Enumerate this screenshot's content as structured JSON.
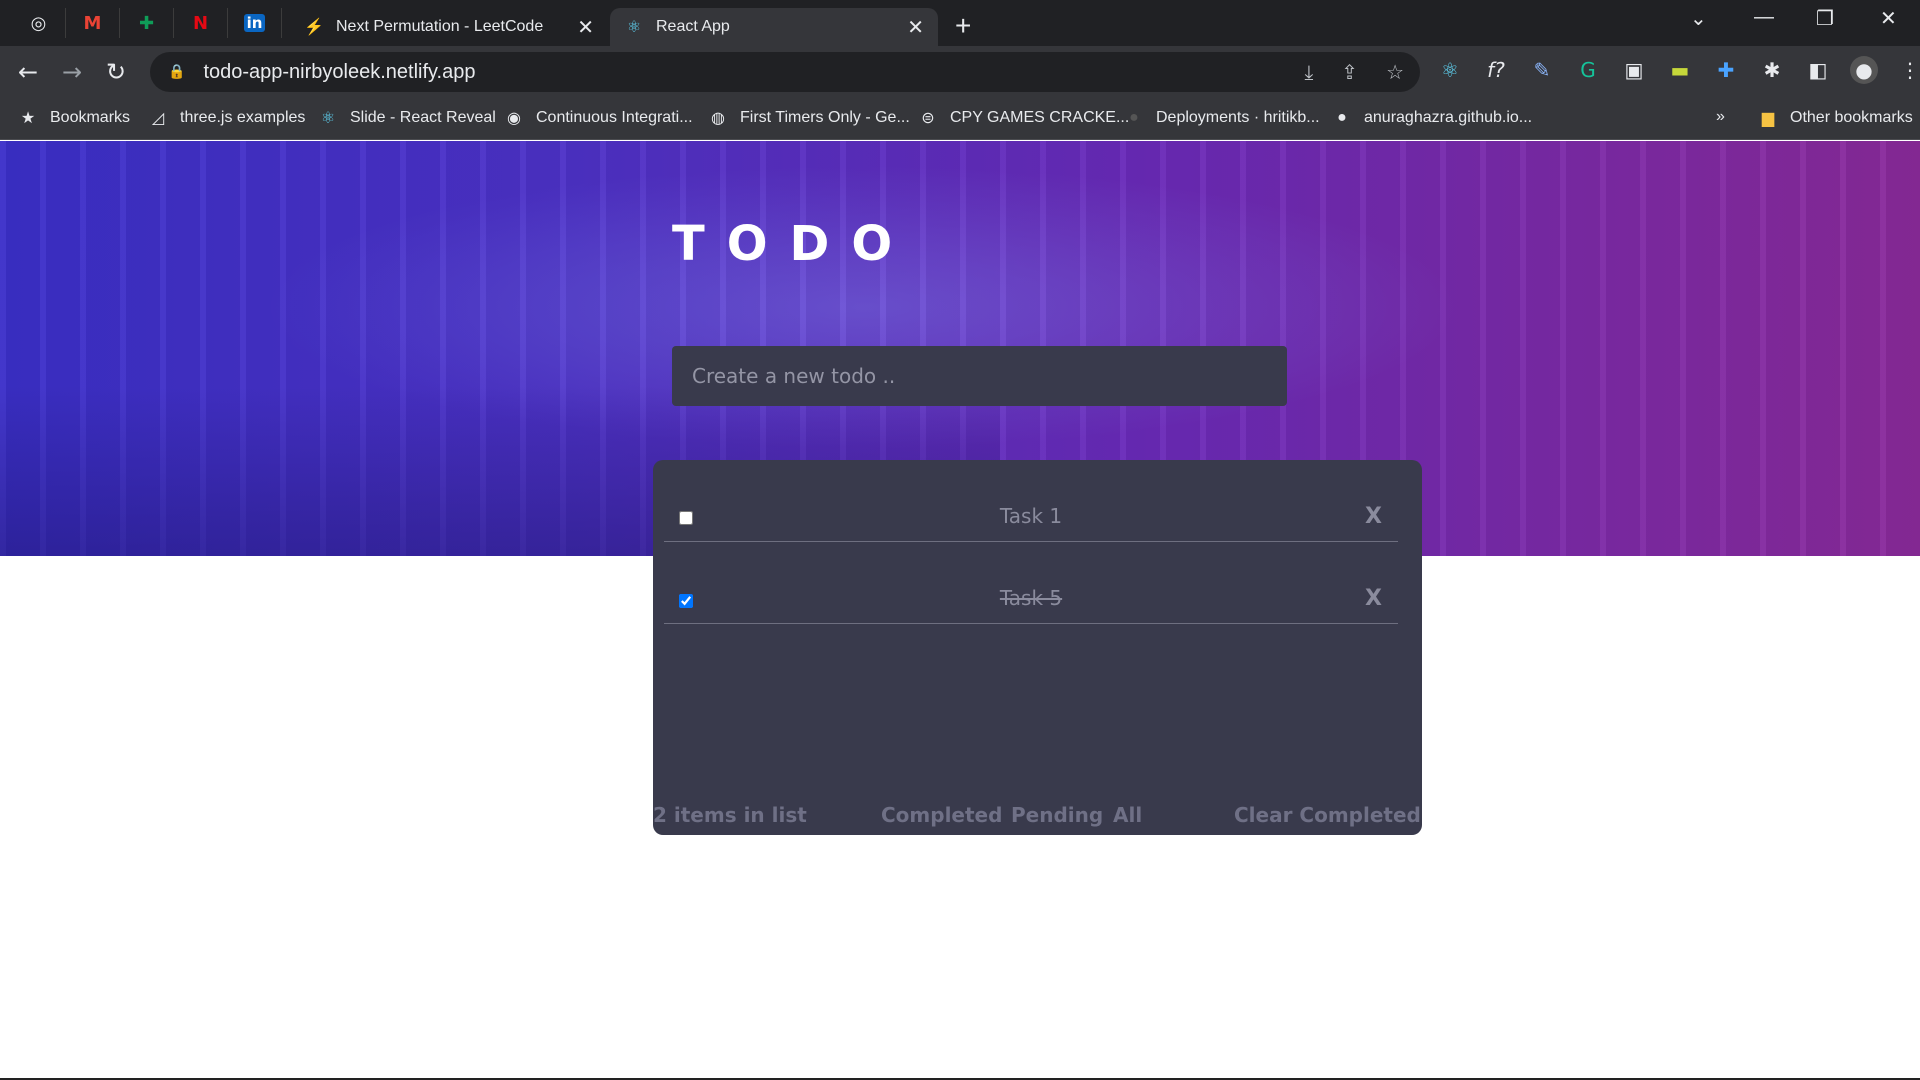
{
  "browser": {
    "pinned_tabs": [
      {
        "icon": "chatgpt-icon",
        "glyph": "◎",
        "color": "#10a37f"
      },
      {
        "icon": "gmail-icon",
        "glyph": "M",
        "color": "#ea4335"
      },
      {
        "icon": "sheets-icon",
        "glyph": "✚",
        "color": "#0f9d58"
      },
      {
        "icon": "netflix-icon",
        "glyph": "N",
        "color": "#e50914"
      },
      {
        "icon": "linkedin-icon",
        "glyph": "in",
        "color": "#0a66c2"
      }
    ],
    "tabs": [
      {
        "title": "Next Permutation - LeetCode",
        "icon": "leetcode-icon",
        "active": false
      },
      {
        "title": "React App",
        "icon": "react-icon",
        "active": true
      }
    ],
    "url": "todo-app-nirbyoleek.netlify.app",
    "bookmarks": [
      {
        "label": "Bookmarks",
        "icon": "star-icon"
      },
      {
        "label": "three.js examples",
        "icon": "threejs-icon"
      },
      {
        "label": "Slide - React Reveal",
        "icon": "react-icon"
      },
      {
        "label": "Continuous Integrati...",
        "icon": "circleci-icon"
      },
      {
        "label": "First Timers Only - Ge...",
        "icon": "globe-icon"
      },
      {
        "label": "CPY GAMES CRACKE...",
        "icon": "cpy-icon"
      },
      {
        "label": "Deployments · hritikb...",
        "icon": "github-icon"
      },
      {
        "label": "anuraghazra.github.io...",
        "icon": "github-icon"
      }
    ],
    "overflow_label": "»",
    "other_bookmarks": "Other bookmarks"
  },
  "app": {
    "title": "TODO",
    "input_placeholder": "Create a new todo ..",
    "todos": [
      {
        "text": "Task 1",
        "completed": false
      },
      {
        "text": "Task 5",
        "completed": true
      }
    ],
    "delete_label": "X",
    "footer": {
      "count": "2 items in list",
      "filter_completed": "Completed",
      "filter_pending": "Pending",
      "filter_all": "All",
      "clear_completed": "Clear Completed"
    }
  },
  "colors": {
    "panel": "#393a4c",
    "muted_text": "#8a8b9d",
    "checkbox_accent": "#1a73e8"
  }
}
